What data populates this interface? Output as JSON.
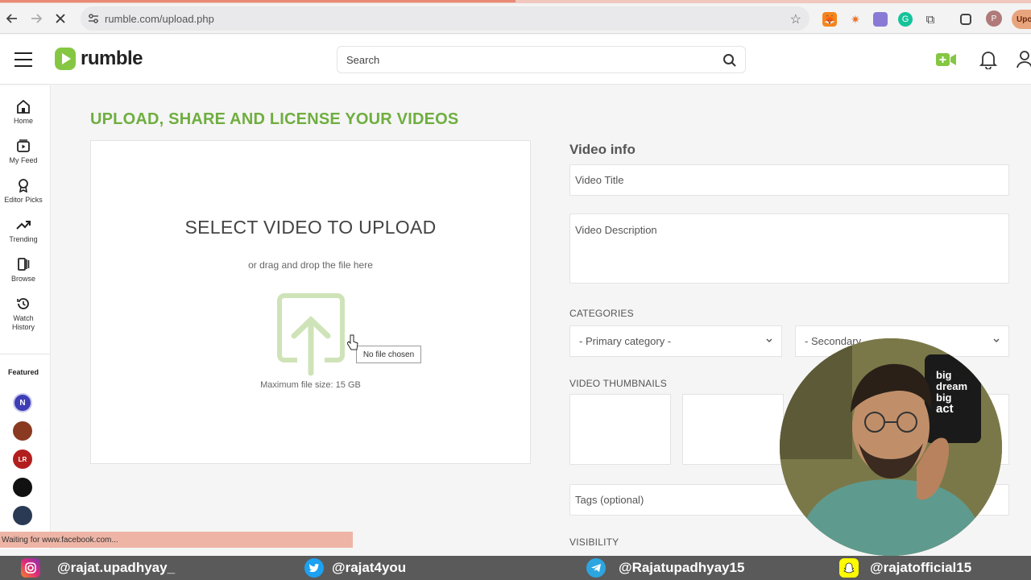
{
  "browser": {
    "url": "rumble.com/upload.php",
    "profile_initial": "P",
    "tab_chip": "Upo"
  },
  "site": {
    "brand": "rumble",
    "search_placeholder": "Search"
  },
  "sidebar": {
    "items": [
      {
        "label": "Home",
        "icon": "home-icon"
      },
      {
        "label": "My Feed",
        "icon": "feed-icon"
      },
      {
        "label": "Editor Picks",
        "icon": "award-icon"
      },
      {
        "label": "Trending",
        "icon": "trending-icon"
      },
      {
        "label": "Browse",
        "icon": "browse-icon"
      },
      {
        "label": "Watch History",
        "icon": "history-icon"
      }
    ],
    "featured_label": "Featured",
    "featured": [
      {
        "initials": "N",
        "color": "#3d3db5"
      },
      {
        "initials": "",
        "color": "#8a3a20"
      },
      {
        "initials": "LR",
        "color": "#b21e1e"
      },
      {
        "initials": "",
        "color": "#111111"
      },
      {
        "initials": "",
        "color": "#2a3a55"
      }
    ]
  },
  "upload": {
    "page_title": "UPLOAD, SHARE AND LICENSE YOUR VIDEOS",
    "heading": "SELECT VIDEO TO UPLOAD",
    "subheading": "or drag and drop the file here",
    "file_status": "No file chosen",
    "max_size": "Maximum file size: 15 GB"
  },
  "video_info": {
    "title": "Video info",
    "title_placeholder": "Video Title",
    "description_placeholder": "Video Description",
    "categories_label": "CATEGORIES",
    "primary_category": "- Primary category -",
    "secondary_category": "- Secondary",
    "thumbnails_label": "VIDEO THUMBNAILS",
    "tags_placeholder": "Tags (optional)",
    "visibility_label": "VISIBILITY"
  },
  "status": {
    "text": "Waiting for www.facebook.com..."
  },
  "social": [
    {
      "handle": "@rajat.upadhyay_",
      "icon": "instagram-icon",
      "color": "#d62976"
    },
    {
      "handle": "@rajat4you",
      "icon": "twitter-icon",
      "color": "#1da1f2"
    },
    {
      "handle": "@Rajatupadhyay15",
      "icon": "telegram-icon",
      "color": "#2ca5e0"
    },
    {
      "handle": "@rajatofficial15",
      "icon": "snapchat-icon",
      "color": "#fffc00"
    }
  ],
  "colors": {
    "brand_green": "#85c742",
    "title_green": "#6fae3f"
  }
}
